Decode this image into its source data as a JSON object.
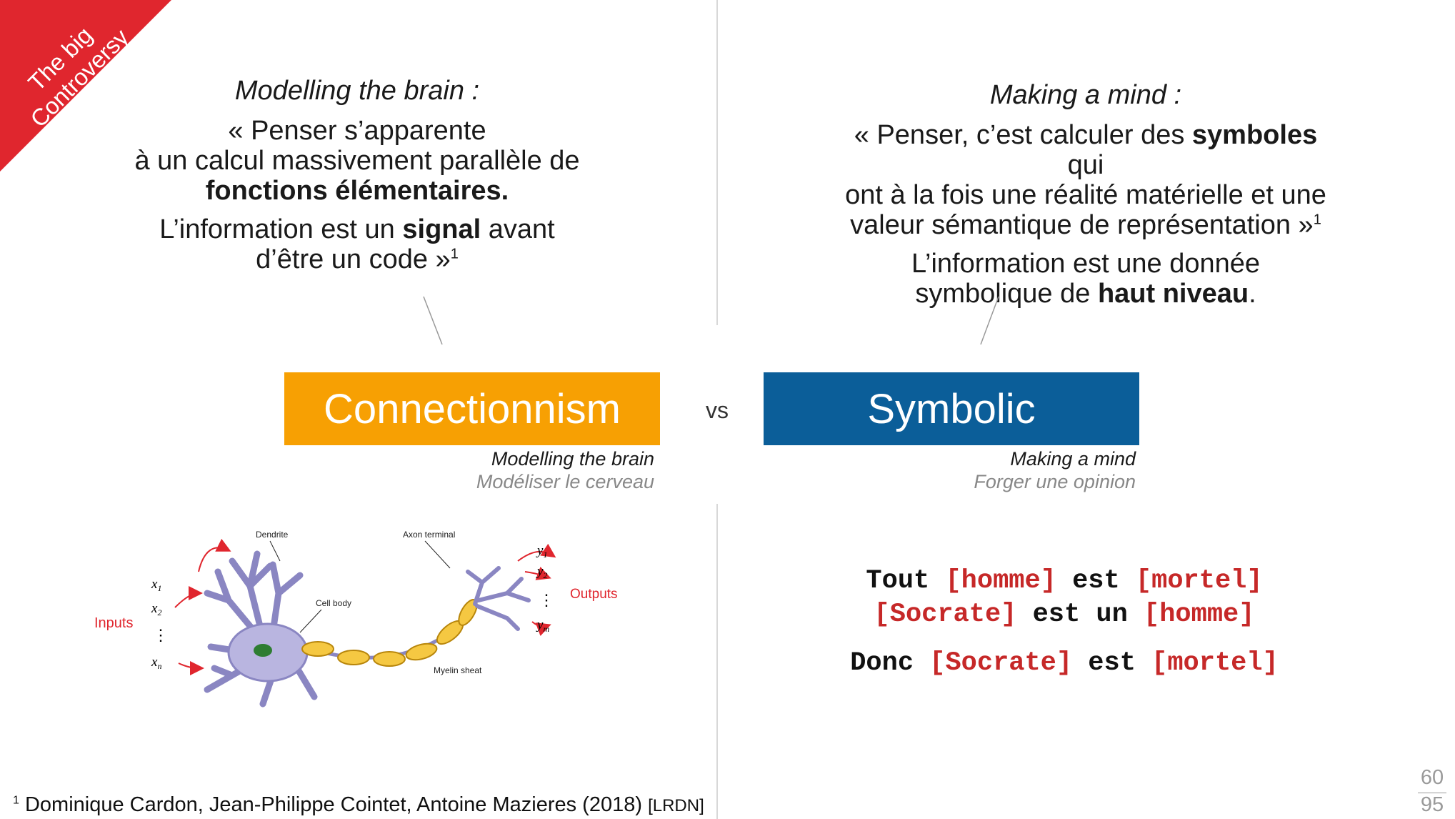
{
  "ribbon": {
    "line1": "The big",
    "line2": "Controversy",
    "color": "#e0262e"
  },
  "left_quote": {
    "heading": "Modelling the brain :",
    "l1": "« Penser s’apparente",
    "l2": "à un calcul massivement parallèle de",
    "l3_bold": "fonctions élémentaires.",
    "l4_pre": "L’information est un ",
    "l4_bold": "signal",
    "l4_post": " avant",
    "l5": "d’être un code »",
    "l5_sup": "1"
  },
  "right_quote": {
    "heading": "Making a mind :",
    "l1_pre": "« Penser, c’est calculer des ",
    "l1_bold": "symboles",
    "l1_post": " qui",
    "l2": "ont à la fois une réalité matérielle et une",
    "l3": "valeur sémantique de représentation »",
    "l3_sup": "1",
    "l4": "L’information est une donnée",
    "l5_pre": "symbolique de ",
    "l5_bold": "haut niveau",
    "l5_post": "."
  },
  "boxes": {
    "connectionnism": {
      "label": "Connectionnism",
      "color": "#f7a003"
    },
    "vs": "vs",
    "symbolic": {
      "label": "Symbolic",
      "color": "#0b5e99"
    }
  },
  "left_sub": {
    "en": "Modelling the brain",
    "fr": "Modéliser le cerveau"
  },
  "right_sub": {
    "en": "Making a mind",
    "fr": "Forger une opinion"
  },
  "neuron": {
    "dendrite": "Dendrite",
    "axon_terminal": "Axon terminal",
    "cell_body": "Cell body",
    "myelin": "Myelin sheat",
    "inputs": "Inputs",
    "outputs": "Outputs",
    "x1": "x",
    "x1_sub": "1",
    "x2": "x",
    "x2_sub": "2",
    "xn": "x",
    "xn_sub": "n",
    "y1": "y",
    "y1_sub": "1",
    "y2": "y",
    "y2_sub": "2",
    "ym": "y",
    "ym_sub": "m",
    "dots": "⋮",
    "arrow_color": "#e0262e"
  },
  "syllogism": {
    "line1": [
      {
        "t": "Tout ",
        "c": "k"
      },
      {
        "t": "[homme]",
        "c": "b"
      },
      {
        "t": " est ",
        "c": "k"
      },
      {
        "t": "[mortel]",
        "c": "b"
      }
    ],
    "line2": [
      {
        "t": "[Socrate]",
        "c": "b"
      },
      {
        "t": " est un ",
        "c": "k"
      },
      {
        "t": "[homme]",
        "c": "b"
      }
    ],
    "line3": [
      {
        "t": "Donc ",
        "c": "k"
      },
      {
        "t": "[Socrate]",
        "c": "b"
      },
      {
        "t": " est ",
        "c": "k"
      },
      {
        "t": "[mortel]",
        "c": "b"
      }
    ]
  },
  "footnote": {
    "sup": "1",
    "text": " Dominique Cardon, Jean-Philippe Cointet, Antoine Mazieres (2018) ",
    "ref": "[LRDN]"
  },
  "page": {
    "current": "60",
    "total": "95"
  }
}
